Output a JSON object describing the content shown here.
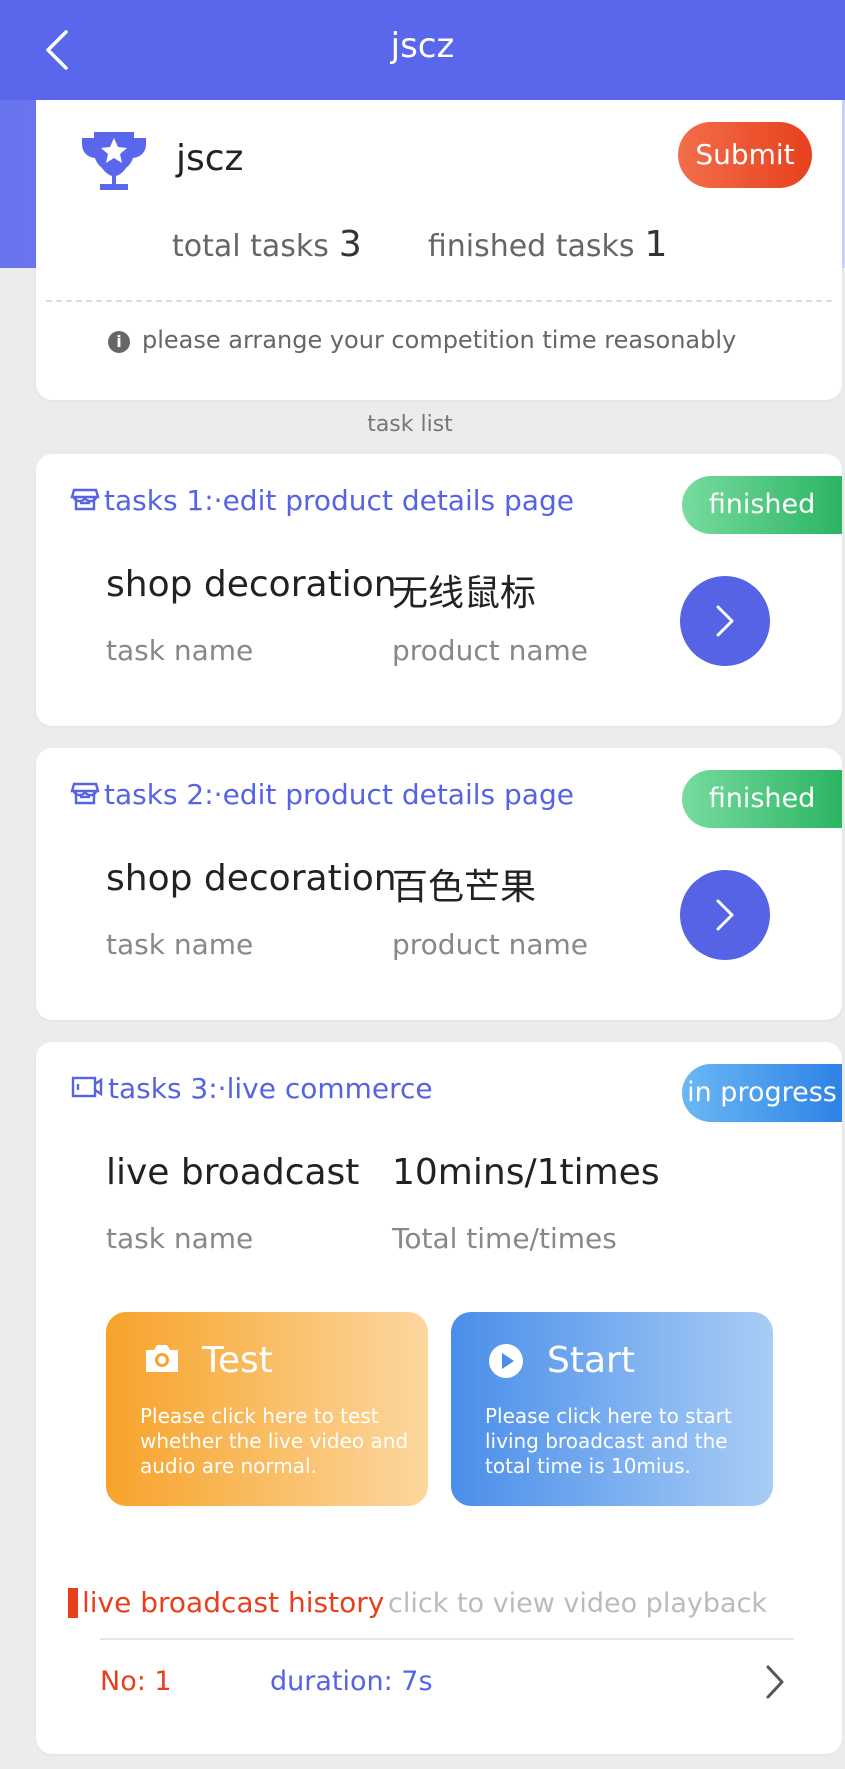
{
  "header": {
    "title": "jscz"
  },
  "summary": {
    "name": "jscz",
    "submit_label": "Submit",
    "total_label": "total tasks",
    "total_value": "3",
    "finished_label": "finished tasks",
    "finished_value": "1",
    "hint": "please arrange your competition time reasonably"
  },
  "section_label": "task list",
  "tasks": [
    {
      "heading": "tasks 1:·edit product details page",
      "status": "finished",
      "value_left": "shop decoration",
      "value_right": "无线鼠标",
      "label_left": "task name",
      "label_right": "product name"
    },
    {
      "heading": "tasks 2:·edit product details page",
      "status": "finished",
      "value_left": "shop decoration",
      "value_right": "百色芒果",
      "label_left": "task name",
      "label_right": "product name"
    },
    {
      "heading": "tasks 3:·live commerce",
      "status": "in progress",
      "value_left": "live broadcast",
      "value_right": "10mins/1times",
      "label_left": "task name",
      "label_right": "Total time/times",
      "test": {
        "title": "Test",
        "desc": "Please click here to test whether the live video and audio are normal."
      },
      "start": {
        "title": "Start",
        "desc": "Please click here to start living broadcast and the total time is 10mius."
      },
      "history": {
        "title": "live broadcast history",
        "subtitle": "click to view video playback",
        "rows": [
          {
            "no": "No: 1",
            "duration": "duration: 7s"
          }
        ]
      }
    }
  ],
  "colors": {
    "primary": "#5563e4",
    "submit": "#e8401d",
    "finished": "#2bb562",
    "in_progress": "#2e82e6"
  }
}
